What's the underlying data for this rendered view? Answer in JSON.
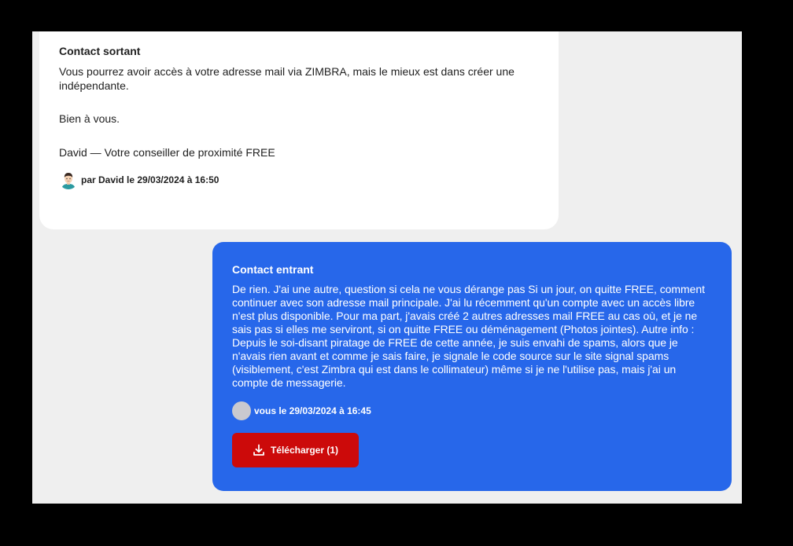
{
  "messages": {
    "outgoing": {
      "title": "Contact sortant",
      "paragraphs": [
        "Vous pourrez avoir accès à votre adresse mail via ZIMBRA, mais le mieux est dans créer une indépendante.",
        "Bien à vous.",
        "David — Votre conseiller de proximité FREE"
      ],
      "meta": "par David le 29/03/2024 à 16:50",
      "avatar_icon": "advisor-avatar-icon"
    },
    "incoming": {
      "title": "Contact entrant",
      "text": "De rien. J'ai une autre, question si cela ne vous dérange pas Si un jour, on quitte FREE, comment continuer avec son adresse mail principale. J'ai lu récemment qu'un compte avec un accès libre n'est plus disponible. Pour ma part, j'avais créé 2 autres adresses mail FREE au cas où, et je ne sais pas si elles me serviront, si on quitte FREE ou déménagement (Photos jointes). Autre info : Depuis le soi-disant piratage de FREE de cette année, je suis envahi de spams, alors que je n'avais rien avant et comme je sais faire, je signale le code source sur le site signal spams (visiblement, c'est Zimbra qui est dans le collimateur) même si je ne l'utilise pas, mais j'ai un compte de messagerie.",
      "meta": "vous le 29/03/2024 à 16:45",
      "avatar_icon": "user-avatar-placeholder",
      "download_label": "Télécharger (1)",
      "download_icon": "download-icon"
    }
  },
  "colors": {
    "incoming_bg": "#2767ea",
    "download_bg": "#cc0a0a",
    "page_bg": "#efefef"
  }
}
